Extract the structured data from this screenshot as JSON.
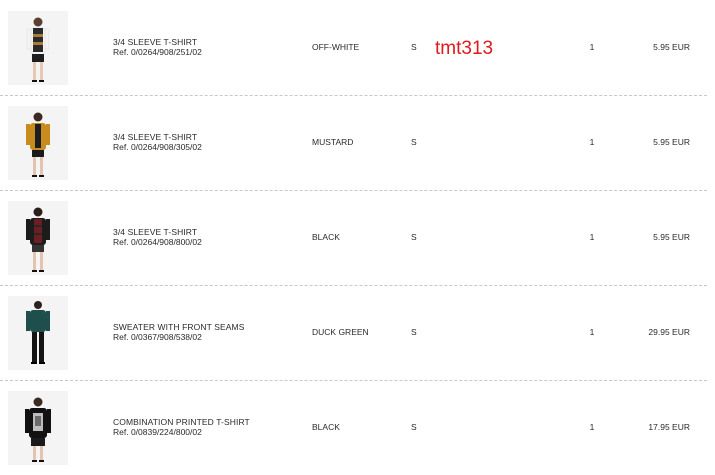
{
  "watermark": "tmt313",
  "items": [
    {
      "name": "3/4 SLEEVE T-SHIRT",
      "ref": "Ref. 0/0264/908/251/02",
      "color": "OFF-WHITE",
      "size": "S",
      "qty": "1",
      "price": "5.95 EUR"
    },
    {
      "name": "3/4 SLEEVE T-SHIRT",
      "ref": "Ref. 0/0264/908/305/02",
      "color": "MUSTARD",
      "size": "S",
      "qty": "1",
      "price": "5.95 EUR"
    },
    {
      "name": "3/4 SLEEVE T-SHIRT",
      "ref": "Ref. 0/0264/908/800/02",
      "color": "BLACK",
      "size": "S",
      "qty": "1",
      "price": "5.95 EUR"
    },
    {
      "name": "SWEATER WITH FRONT SEAMS",
      "ref": "Ref. 0/0367/908/538/02",
      "color": "DUCK GREEN",
      "size": "S",
      "qty": "1",
      "price": "29.95 EUR"
    },
    {
      "name": "COMBINATION PRINTED T-SHIRT",
      "ref": "Ref. 0/0839/224/800/02",
      "color": "BLACK",
      "size": "S",
      "qty": "1",
      "price": "17.95 EUR"
    }
  ],
  "colors": {
    "background": "#ffffff",
    "text": "#2a2a2a",
    "divider": "#c8c8c8",
    "watermark": "#e0181c"
  }
}
